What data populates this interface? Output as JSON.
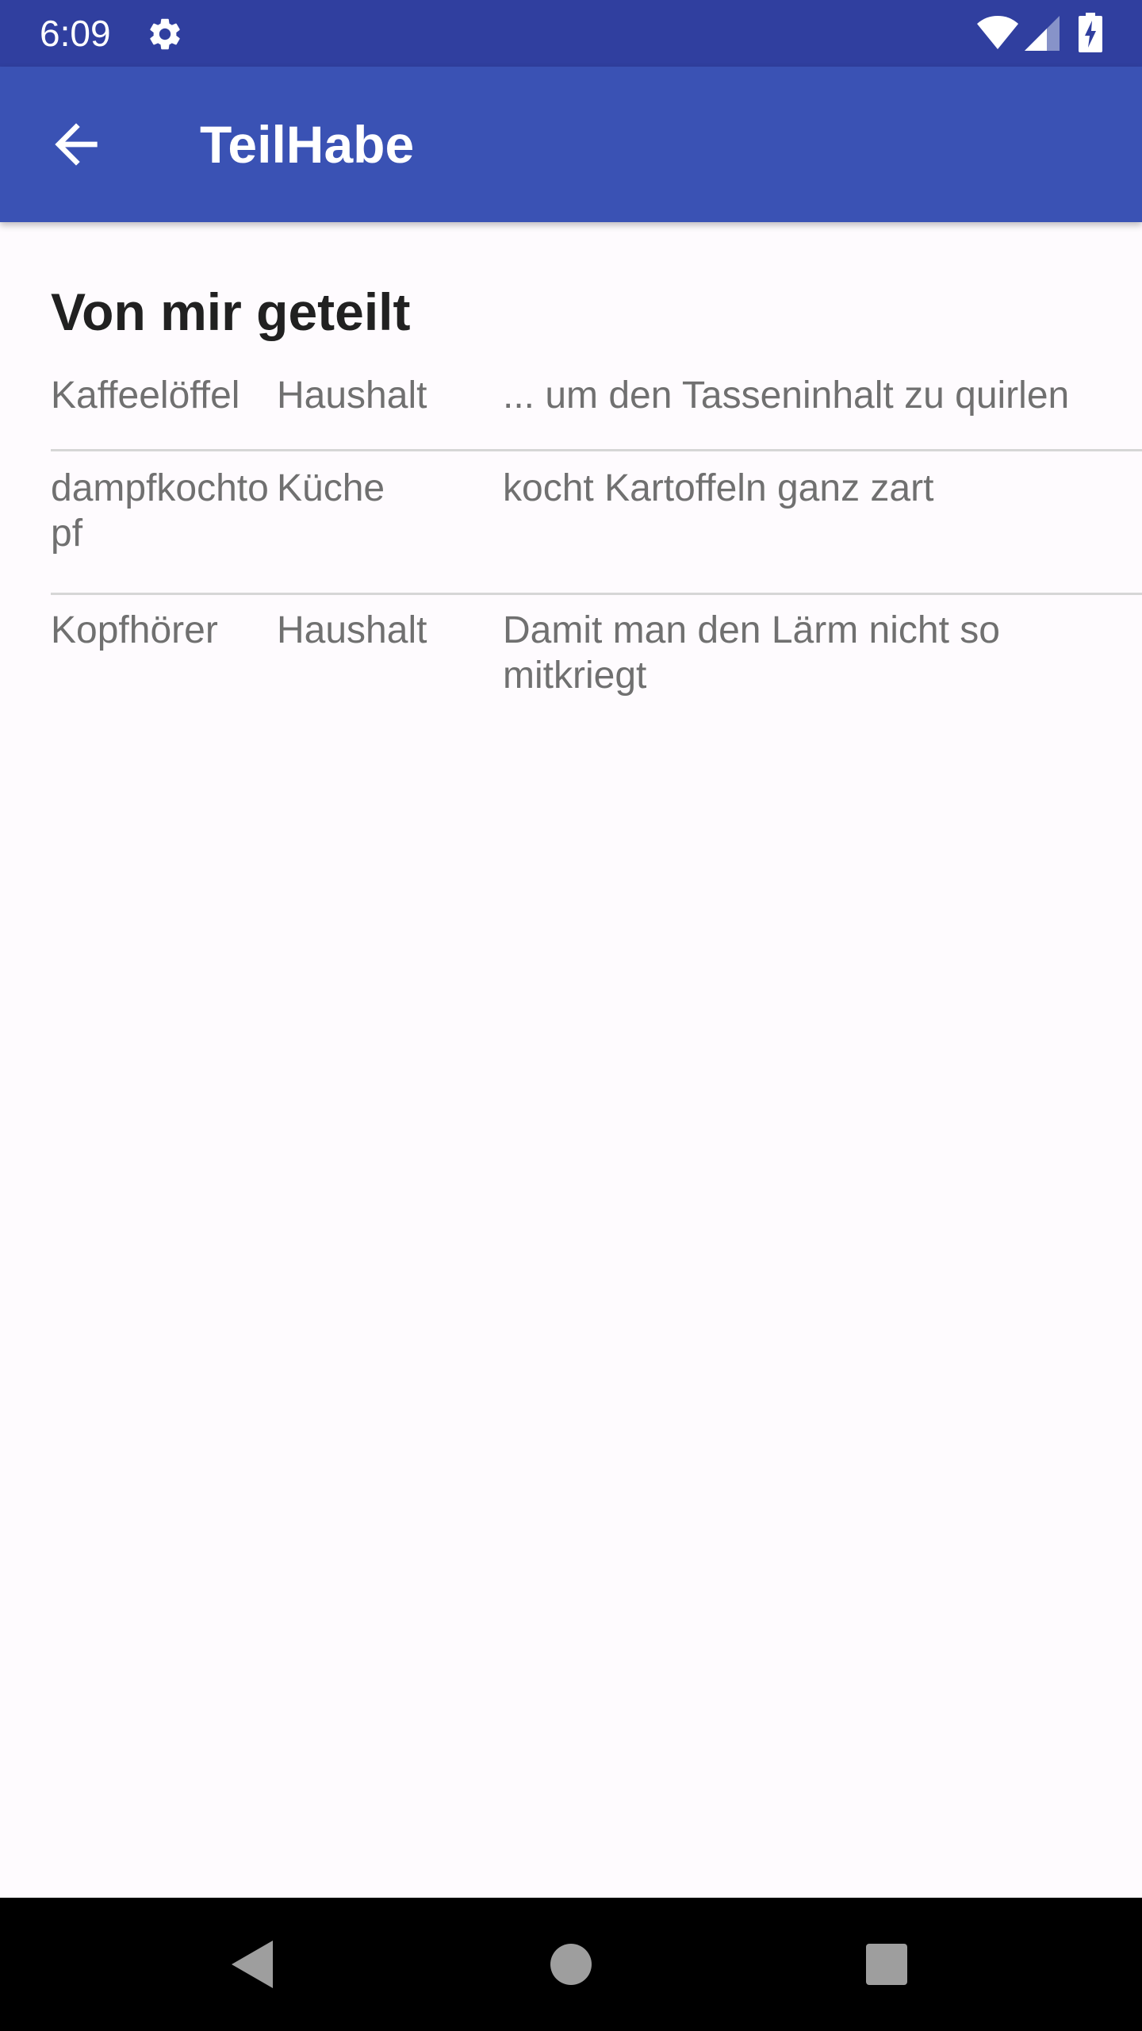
{
  "status_bar": {
    "time": "6:09",
    "icons": [
      "gear-icon",
      "wifi-icon",
      "signal-icon",
      "battery-charging-icon"
    ]
  },
  "app_bar": {
    "back_icon": "arrow-left-icon",
    "title": "TeilHabe"
  },
  "section": {
    "title": "Von mir geteilt"
  },
  "items": [
    {
      "name": "Kaffeelöffel",
      "category": "Haushalt",
      "description": "... um den Tasseninhalt zu quirlen"
    },
    {
      "name": "dampfkochtopf",
      "category": "Küche",
      "description": "kocht Kartoffeln ganz zart"
    },
    {
      "name": "Kopfhörer",
      "category": "Haushalt",
      "description": "Damit man den Lärm nicht so mitkriegt"
    }
  ],
  "nav_bar": {
    "icons": [
      "nav-back-icon",
      "nav-home-icon",
      "nav-recents-icon"
    ]
  },
  "colors": {
    "status_bar": "#303f9f",
    "app_bar": "#3a52b4",
    "background": "#fefbfe",
    "text_primary": "#212121",
    "text_secondary": "#707070",
    "divider": "#d6d6d6"
  }
}
